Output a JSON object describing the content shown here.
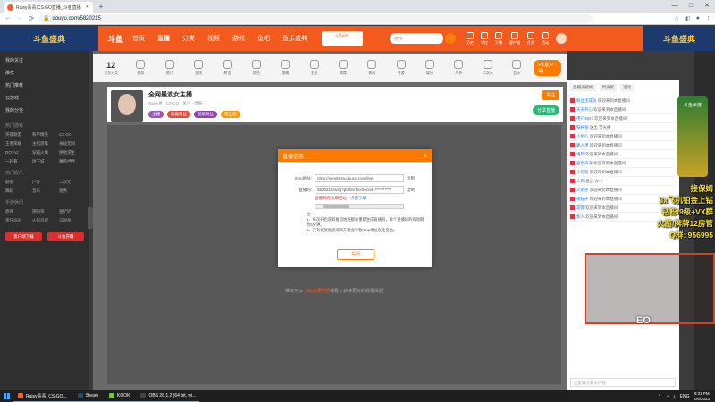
{
  "browser": {
    "tab_title": "Raisy青青|CS:GO直播_斗鱼直播",
    "url": "douyu.com/5820215",
    "new_tab": "+",
    "controls": [
      "—",
      "□",
      "✕"
    ]
  },
  "header": {
    "banner_left": "斗鱼盛典",
    "banner_right": "斗鱼盛典",
    "logo": "斗鱼",
    "nav": [
      "首页",
      "直播",
      "分类",
      "视频",
      "游戏",
      "鱼吧",
      "鱼乐盛典"
    ],
    "active_nav": "直播",
    "download_card": "斗鱼APP",
    "search_placeholder": "搜索",
    "icons": [
      "历史",
      "关注",
      "开播",
      "客户端",
      "任务",
      "活动"
    ]
  },
  "sidebar": {
    "items": [
      "我的关注",
      "推荐",
      "热门推荐",
      "云游戏",
      "我的分类"
    ],
    "section_popular": "热门游戏",
    "popular": [
      "英雄联盟",
      "和平精英",
      "CS:GO",
      "王者荣耀",
      "主机游戏",
      "永劫无间",
      "DOTA2",
      "穿越火线",
      "绝地求生",
      "一起看",
      "地下城",
      "魔兽世界"
    ],
    "section_hot": "热门娱乐",
    "hot": [
      "颜值",
      "户外",
      "二次元",
      "舞蹈",
      "音乐",
      "星秀"
    ],
    "section_mobile": "手游休闲",
    "mobile": [
      "原神",
      "阴阳师",
      "金铲铲",
      "蛋仔派对",
      "火影忍者",
      "三国杀"
    ],
    "btn_left": "客户端下载",
    "btn_right": "斗鱼开播"
  },
  "categories": {
    "count": "12",
    "count_label": "全部分类",
    "items": [
      "推荐",
      "热门",
      "竞技",
      "射击",
      "角色",
      "策略",
      "主机",
      "体育",
      "休闲",
      "手游",
      "娱乐",
      "户外",
      "二次元",
      "音乐",
      "棋牌",
      "更多"
    ],
    "pc_button": "PC客户端"
  },
  "room": {
    "title": "全网最浪女主播",
    "meta": "Raisy青 · CS:GO · 关注 · 举报",
    "tags": [
      "主播",
      "高能粉丝",
      "超级粉丝",
      "粉丝团"
    ],
    "tag_colors": [
      "#9b59b6",
      "#e74c3c",
      "#8e44ad",
      "#f39c12"
    ],
    "follow": "关注",
    "share": "分享直播"
  },
  "player": {
    "message_prefix": "推流可以",
    "message_highlight": "下载直播伴侣",
    "message_suffix": "观看，获得更好的观看体验"
  },
  "modal": {
    "title": "直播信息",
    "close": "×",
    "rtmp_label": "rtmp地址:",
    "rtmp_value": "rtmp://sendtc3a.douyu.com/live",
    "key_label": "直播码:",
    "key_value": "5820215rw3p?pGDSTxxSecret=**********",
    "copy": "复制",
    "valid_text": "直播码有效期已过",
    "valid_link": "点击了解",
    "notes": [
      "注:",
      "1、每次开启获取推流地址都会重新生成直播码，每个直播码的有效期为5分钟。",
      "2、只有切换推流或断开后会导致rtmp地址发生变化。"
    ],
    "close_btn": "关闭"
  },
  "right_panel": {
    "tabs": [
      "直播贡献榜",
      "周贡献",
      "活动"
    ],
    "rows": [
      {
        "name": "粉丝团成员",
        "text": "欢迎来到本直播间"
      },
      {
        "name": "天天开心",
        "text": "欢迎来到本直播间"
      },
      {
        "name": "用户8827",
        "text": "欢迎来到本直播间"
      },
      {
        "name": "铁杆粉",
        "text": "送出 荧光棒"
      },
      {
        "name": "小鱼儿",
        "text": "欢迎来到本直播间"
      },
      {
        "name": "路人甲",
        "text": "欢迎来到本直播间"
      },
      {
        "name": "清风",
        "text": "欢迎来到本直播间"
      },
      {
        "name": "蓝色海洋",
        "text": "欢迎来到本直播间"
      },
      {
        "name": "小可爱",
        "text": "欢迎来到本直播间"
      },
      {
        "name": "大白",
        "text": "送出 办卡"
      },
      {
        "name": "火箭手",
        "text": "欢迎来到本直播间"
      },
      {
        "name": "夜猫子",
        "text": "欢迎来到本直播间"
      },
      {
        "name": "游客",
        "text": "欢迎来到本直播间"
      },
      {
        "name": "新人",
        "text": "欢迎来到本直播间"
      }
    ],
    "input_placeholder": "这里输入聊天内容"
  },
  "overlay": {
    "promo": [
      "接保姆",
      "3x飞机铂金上钻",
      "钻粉/9级+VX群",
      "火箭/牌牌12房管",
      "Q群: 956995"
    ],
    "badge": "斗鱼年度",
    "cam_logo": "EO"
  },
  "taskbar": {
    "apps": [
      {
        "name": "Raisy青青_CS:GO...",
        "color": "#ff5d23"
      },
      {
        "name": "Steam",
        "color": "#2a475e"
      },
      {
        "name": "KOOK",
        "color": "#6aca3a"
      },
      {
        "name": "OBS 28.1.2 (64 bit, wi...",
        "color": "#444444"
      }
    ],
    "lang": "ENG",
    "time": "9:31 PM",
    "date": "1/6/2023"
  }
}
